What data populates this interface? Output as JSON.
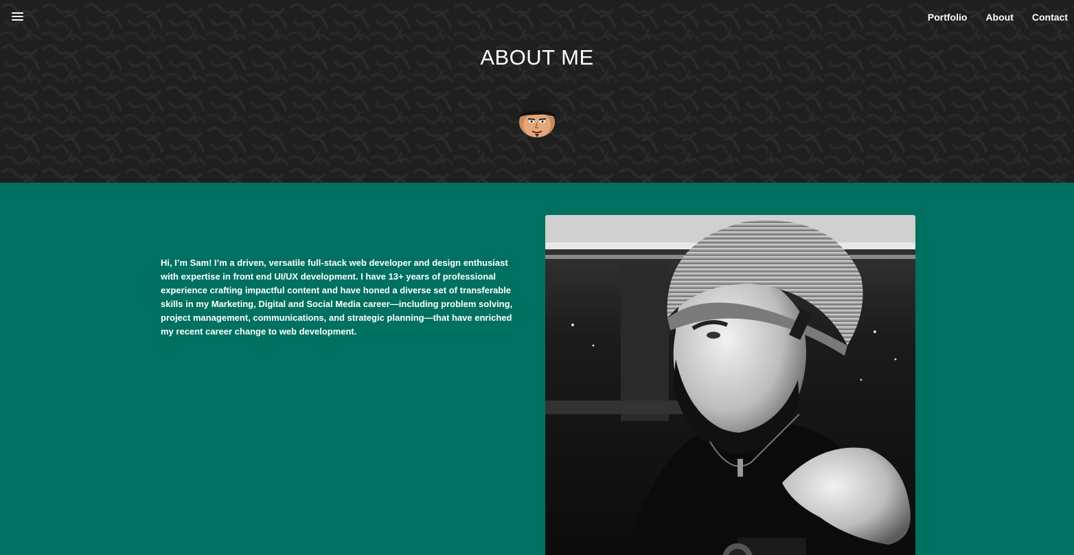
{
  "nav": {
    "items": [
      {
        "label": "Portfolio"
      },
      {
        "label": "About"
      },
      {
        "label": "Contact"
      }
    ]
  },
  "header": {
    "title": "ABOUT ME",
    "background_color": "#1f1f1f"
  },
  "main": {
    "background_color": "#007161",
    "bio": "Hi, I’m Sam! I’m a driven, versatile full-stack web developer and design enthusiast with expertise in front end UI/UX development. I have 13+ years of professional experience crafting impactful content and have honed a diverse set of transferable skills in my Marketing, Digital and Social Media career—including problem solving, project management, communications, and strategic planning—that have enriched my recent career change to web development."
  },
  "icons": {
    "menu": "hamburger-menu-icon",
    "avatar": "cartoon-avatar",
    "photo": "profile-photo"
  }
}
